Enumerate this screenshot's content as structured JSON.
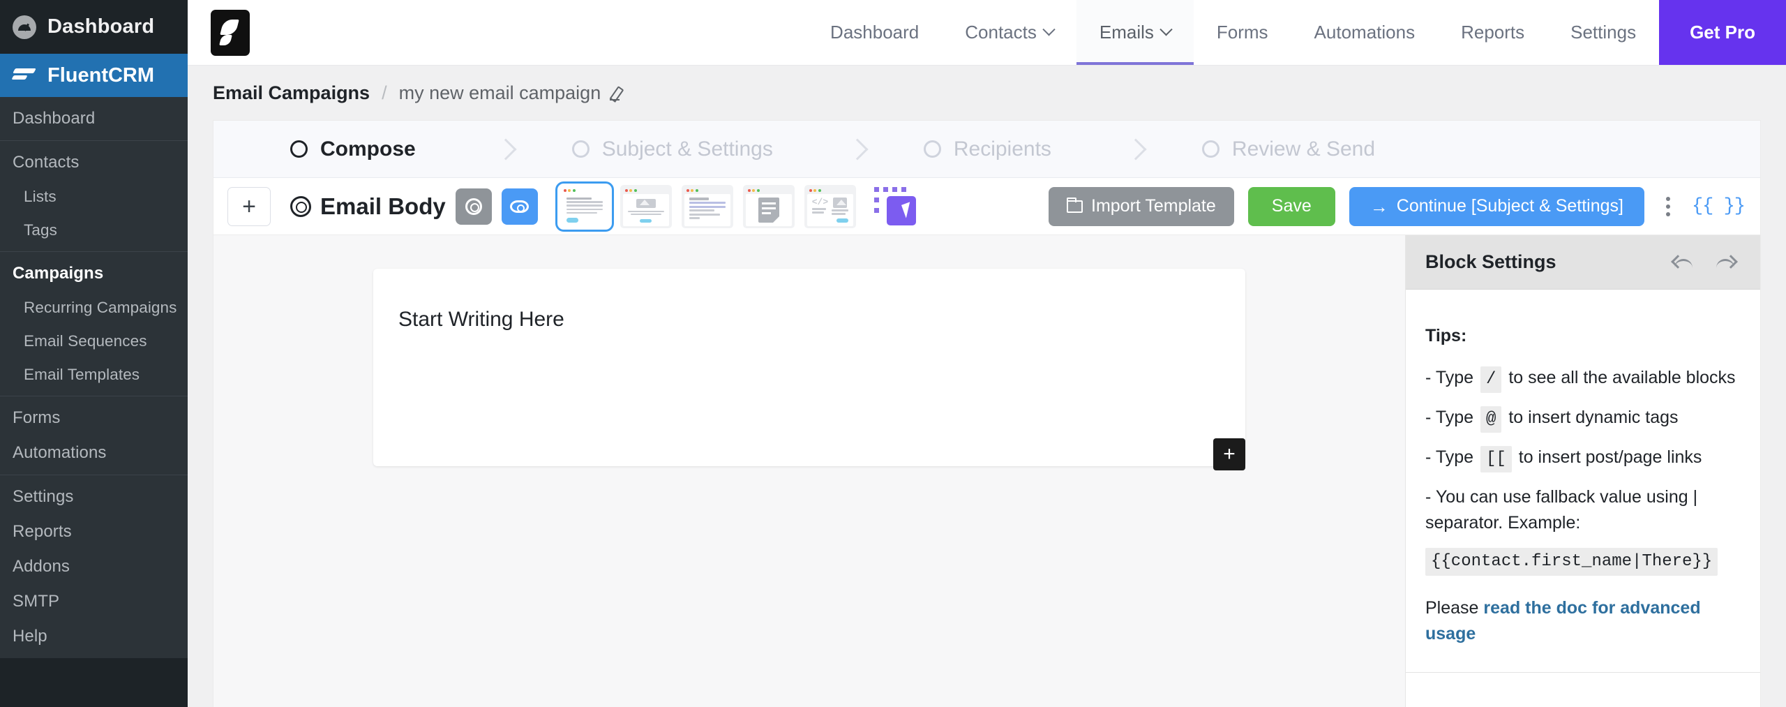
{
  "wp_sidebar": {
    "dashboard_label": "Dashboard",
    "active_label": "FluentCRM",
    "groups": [
      {
        "items": [
          {
            "label": "Dashboard",
            "level": "top"
          }
        ]
      },
      {
        "items": [
          {
            "label": "Contacts",
            "level": "top"
          },
          {
            "label": "Lists",
            "level": "sub"
          },
          {
            "label": "Tags",
            "level": "sub"
          }
        ]
      },
      {
        "items": [
          {
            "label": "Campaigns",
            "level": "head"
          },
          {
            "label": "Recurring Campaigns",
            "level": "sub"
          },
          {
            "label": "Email Sequences",
            "level": "sub"
          },
          {
            "label": "Email Templates",
            "level": "sub"
          }
        ]
      },
      {
        "items": [
          {
            "label": "Forms",
            "level": "top"
          },
          {
            "label": "Automations",
            "level": "top"
          }
        ]
      },
      {
        "items": [
          {
            "label": "Settings",
            "level": "top"
          },
          {
            "label": "Reports",
            "level": "top"
          },
          {
            "label": "Addons",
            "level": "top"
          },
          {
            "label": "SMTP",
            "level": "top"
          },
          {
            "label": "Help",
            "level": "top"
          }
        ]
      }
    ]
  },
  "topnav": {
    "items": [
      {
        "label": "Dashboard",
        "caret": false,
        "active": false
      },
      {
        "label": "Contacts",
        "caret": true,
        "active": false
      },
      {
        "label": "Emails",
        "caret": true,
        "active": true
      },
      {
        "label": "Forms",
        "caret": false,
        "active": false
      },
      {
        "label": "Automations",
        "caret": false,
        "active": false
      },
      {
        "label": "Reports",
        "caret": false,
        "active": false
      },
      {
        "label": "Settings",
        "caret": false,
        "active": false
      }
    ],
    "pro_label": "Get Pro",
    "pro_color": "#6633ee",
    "active_underline_color": "#7f74d8"
  },
  "breadcrumb": {
    "root": "Email Campaigns",
    "separator": "/",
    "current": "my new email campaign"
  },
  "steps": [
    {
      "label": "Compose",
      "state": "current"
    },
    {
      "label": "Subject & Settings",
      "state": "pending"
    },
    {
      "label": "Recipients",
      "state": "pending"
    },
    {
      "label": "Review & Send",
      "state": "pending"
    }
  ],
  "toolbar": {
    "add_label": "+",
    "title": "Email Body",
    "settings_icon": "gear-icon",
    "preview_icon": "eye-icon",
    "templates": [
      {
        "name": "text-template",
        "selected": true
      },
      {
        "name": "image-template",
        "selected": false
      },
      {
        "name": "article-template",
        "selected": false
      },
      {
        "name": "plain-doc-template",
        "selected": false
      },
      {
        "name": "html-code-template",
        "selected": false
      }
    ],
    "drag_template_name": "drag-drop-template",
    "import_label": "Import Template",
    "save_label": "Save",
    "continue_label": "Continue [Subject & Settings]",
    "continue_arrow": "→",
    "more_icon": "kebab-menu-icon",
    "smartcode_label": "{{ }}",
    "save_color": "#5fbe4d",
    "continue_color": "#4a9af5",
    "import_color": "#8f9499"
  },
  "editor": {
    "placeholder_text": "Start Writing Here",
    "add_block_label": "+"
  },
  "right_panel": {
    "title": "Block Settings",
    "undo_icon": "undo-arrow-icon",
    "redo_icon": "redo-arrow-icon",
    "tips_heading": "Tips:",
    "tip1_pre": "- Type",
    "tip1_key": "/",
    "tip1_post": "to see all the available blocks",
    "tip2_pre": "- Type",
    "tip2_key": "@",
    "tip2_post": "to insert dynamic tags",
    "tip3_pre": "- Type",
    "tip3_key": "[[",
    "tip3_post": "to insert post/page links",
    "tip4_text": "- You can use fallback value using | separator. Example:",
    "tip4_code": "{{contact.first_name|There}}",
    "doc_pre": "Please",
    "doc_link": "read the doc for advanced usage",
    "doc_link_color": "#2e6f9e"
  }
}
